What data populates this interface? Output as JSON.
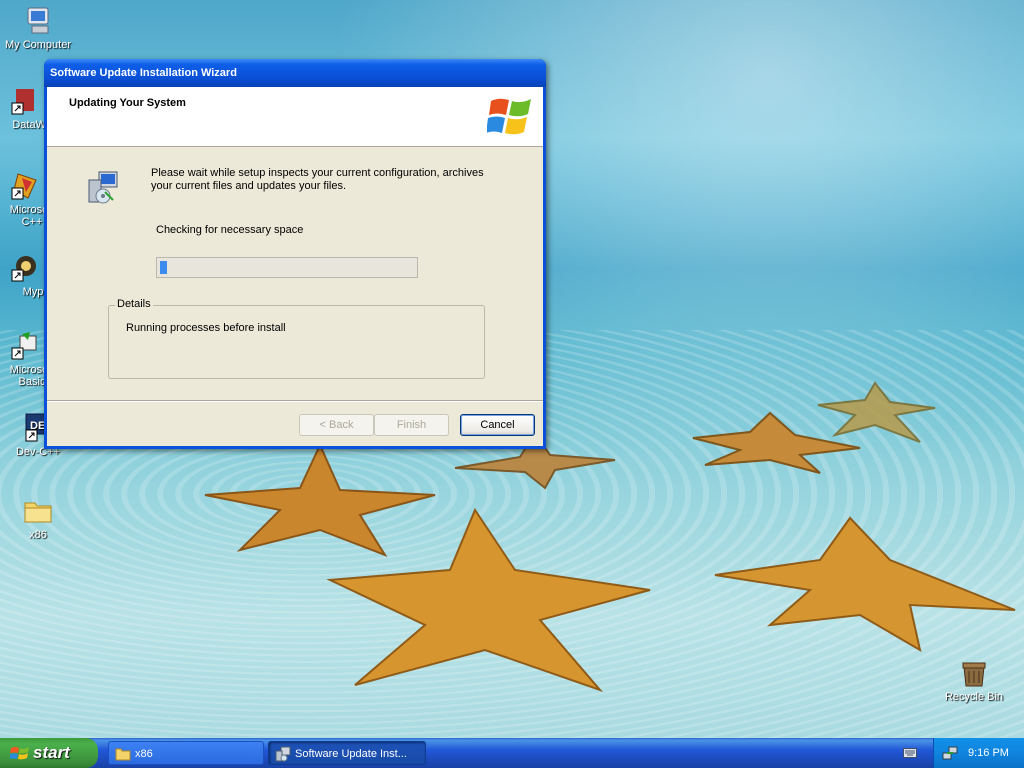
{
  "desktop": {
    "icons": [
      {
        "label": "My Computer",
        "icon": "my-computer-icon"
      },
      {
        "label": "DataWa",
        "icon": "datawa-shortcut-icon"
      },
      {
        "label": "Microsoft C++",
        "icon": "visual-cpp-shortcut-icon"
      },
      {
        "label": "Myp",
        "icon": "myp-shortcut-icon"
      },
      {
        "label": "Microsoft Basic",
        "icon": "visual-basic-shortcut-icon"
      },
      {
        "label": "Dev-C++",
        "icon": "dev-cpp-shortcut-icon"
      },
      {
        "label": "x86",
        "icon": "folder-icon"
      },
      {
        "label": "Recycle Bin",
        "icon": "recycle-bin-icon"
      }
    ]
  },
  "wizard": {
    "title": "Software Update Installation Wizard",
    "banner_title": "Updating Your System",
    "message": "Please wait while setup inspects your current configuration, archives your current files and updates your files.",
    "status": "Checking for necessary space",
    "progress": 0.03,
    "details_label": "Details",
    "details_text": "Running processes before install",
    "buttons": {
      "back": "< Back",
      "finish": "Finish",
      "cancel": "Cancel"
    }
  },
  "taskbar": {
    "start_label": "start",
    "tasks": [
      {
        "label": "x86",
        "icon": "folder-icon",
        "active": false
      },
      {
        "label": "Software Update Inst...",
        "icon": "setup-icon",
        "active": true
      }
    ],
    "clock": "9:16 PM"
  },
  "colors": {
    "titlebar": "#0a4fd6",
    "taskbar": "#2157d7",
    "start_button": "#3a8f3a",
    "progress_fill": "#3c8cf0",
    "dialog_face": "#ece9d8"
  }
}
